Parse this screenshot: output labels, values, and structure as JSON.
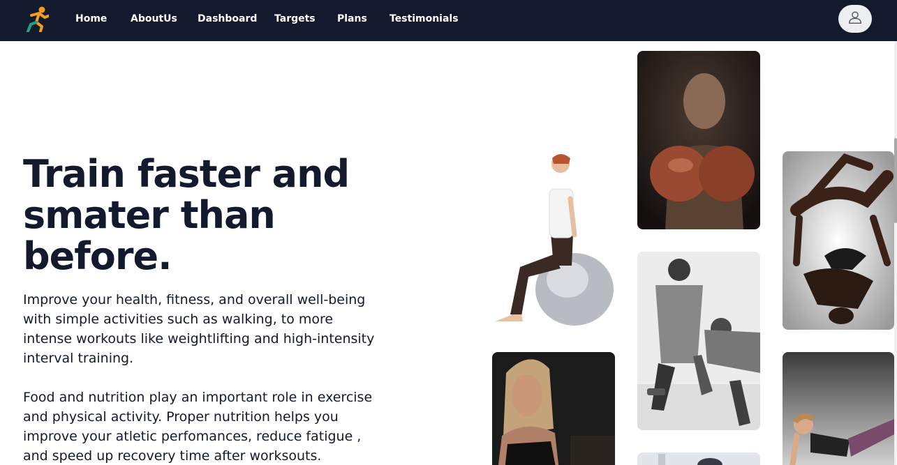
{
  "nav": {
    "links": [
      {
        "label": "Home"
      },
      {
        "label": "AboutUs"
      },
      {
        "label": "Dashboard"
      },
      {
        "label": "Targets"
      },
      {
        "label": "Plans"
      },
      {
        "label": "Testimonials"
      }
    ],
    "logo_icon": "runner-logo-icon",
    "profile_icon": "user-icon"
  },
  "hero": {
    "title": "Train faster and smater than before.",
    "paragraph_1": "Improve your health, fitness, and overall well-being with simple activities such as walking, to more intense workouts like weightlifting and high-intensity interval training.",
    "paragraph_2": "Food and nutrition play an important role in exercise and physical activity. Proper nutrition helps you improve your atletic perfomances, reduce fatigue , and speed up recovery time after worksouts."
  },
  "gallery": {
    "photos": [
      {
        "subject": "woman sitting on exercise ball"
      },
      {
        "subject": "boxer with gloves"
      },
      {
        "subject": "men doing push-ups with dumbbells"
      },
      {
        "subject": "woman in black sports top"
      },
      {
        "subject": "acrobatic yoga pair"
      },
      {
        "subject": "woman doing plank with leg raise"
      },
      {
        "subject": "partial photo"
      }
    ]
  },
  "colors": {
    "navbar_bg": "#141a2e",
    "text_dark": "#141a2e",
    "logo_orange": "#f39c1d",
    "logo_green": "#1aa38a"
  }
}
